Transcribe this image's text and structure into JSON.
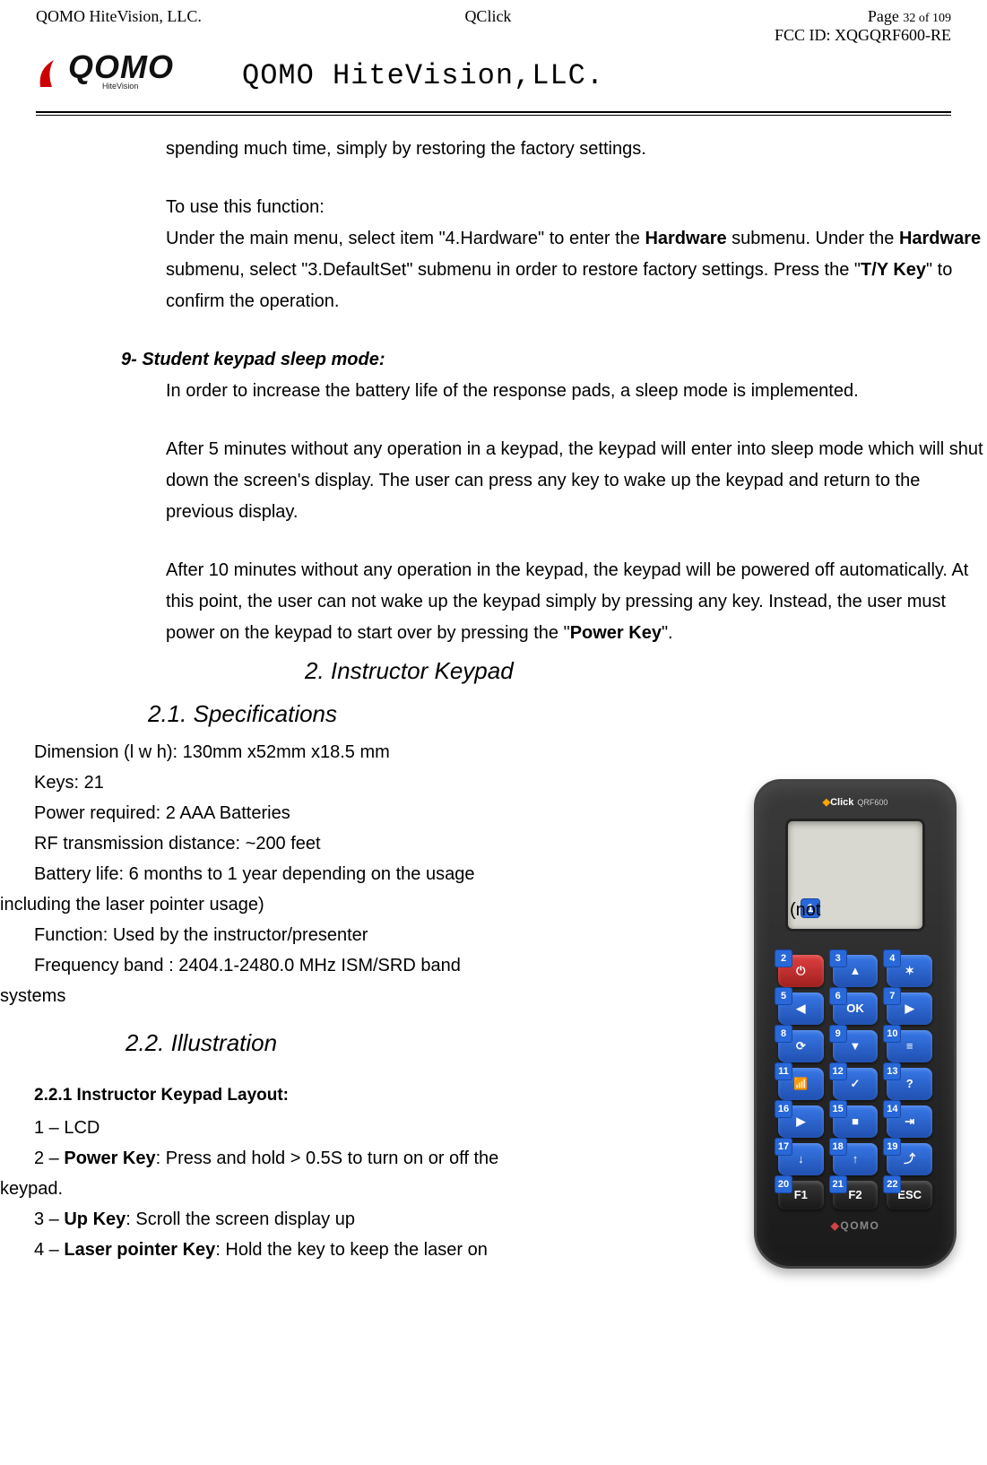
{
  "header": {
    "left": "QOMO HiteVision, LLC.",
    "center": "QClick",
    "page_label": "Page ",
    "page_current": "32",
    "page_of": " of ",
    "page_total": "109",
    "fcc": "FCC ID: XQGQRF600-RE"
  },
  "logo": {
    "brand": "QOMO",
    "sub": "HiteVision",
    "company": "QOMO HiteVision,LLC."
  },
  "body": {
    "p1": "spending much time, simply by restoring the factory settings.",
    "p2": "To use this function:",
    "p3a": "Under the main menu, select item \"4.Hardware\" to enter the ",
    "p3b": "Hardware",
    "p3c": " submenu. Under the ",
    "p3d": "Hardware",
    "p3e": " submenu, select \"3.DefaultSet\" submenu in order to restore factory settings. Press the \"",
    "p3f": "T/Y Key",
    "p3g": "\" to confirm the operation.",
    "s9": "9-  Student keypad sleep mode:",
    "p4": "In order to increase the battery life of the response pads, a sleep mode is implemented.",
    "p5": "After 5 minutes without any operation in a keypad, the keypad will enter into sleep mode which will shut down the screen's display. The user can press any key to wake up the keypad and return to the previous display.",
    "p6a": "After 10 minutes without any operation in the keypad, the keypad will be powered off automatically. At this point, the user can not wake up the keypad simply by pressing any key. Instead, the user must power on the keypad to start over by pressing the \"",
    "p6b": "Power Key",
    "p6c": "\".",
    "h2": "2. Instructor Keypad",
    "h21": "2.1. Specifications",
    "spec1": "Dimension (l w h): 130mm x52mm x18.5 mm",
    "spec2": "Keys: 21",
    "spec3": "Power required: 2 AAA Batteries",
    "spec4": "RF transmission distance: ~200 feet",
    "spec5": "Battery life:    6 months to 1 year depending on the usage",
    "spec5b": "(not",
    "spec5c": "including the laser pointer usage)",
    "spec6": "Function: Used by the instructor/presenter",
    "spec7": " Frequency band : 2404.1-2480.0 MHz ISM/SRD band",
    "spec7b": "systems",
    "h22": "2.2. Illustration",
    "h221": "2.2.1 Instructor Keypad Layout:",
    "k1": "1 – LCD",
    "k2a": "2 – ",
    "k2b": "Power Key",
    "k2c": ": Press and hold > 0.5S to turn on or off the",
    "k2d": "keypad.",
    "k3a": "3 – ",
    "k3b": "Up Key",
    "k3c": ": Scroll the screen display up",
    "k4a": "4 – ",
    "k4b": "Laser pointer Key",
    "k4c": ": Hold the key to keep the laser on"
  },
  "device": {
    "brand_logo": "Click",
    "model": "QRF600",
    "screen_badge": "1",
    "keys": [
      [
        {
          "n": "2",
          "icon": "⏻",
          "cls": "red"
        },
        {
          "n": "3",
          "icon": "▲",
          "cls": "blue"
        },
        {
          "n": "4",
          "icon": "✶",
          "cls": "blue"
        }
      ],
      [
        {
          "n": "5",
          "icon": "◀",
          "cls": "blue"
        },
        {
          "n": "6",
          "icon": "OK",
          "cls": "blue"
        },
        {
          "n": "7",
          "icon": "▶",
          "cls": "blue"
        }
      ],
      [
        {
          "n": "8",
          "icon": "⟳",
          "cls": "blue"
        },
        {
          "n": "9",
          "icon": "▼",
          "cls": "blue"
        },
        {
          "n": "10",
          "icon": "≡",
          "cls": "blue"
        }
      ],
      [
        {
          "n": "11",
          "icon": "📶",
          "cls": "blue"
        },
        {
          "n": "12",
          "icon": "✓",
          "cls": "blue"
        },
        {
          "n": "13",
          "icon": "?",
          "cls": "blue"
        }
      ],
      [
        {
          "n": "16",
          "icon": "▶",
          "cls": "blue"
        },
        {
          "n": "15",
          "icon": "■",
          "cls": "blue"
        },
        {
          "n": "14",
          "icon": "⇥",
          "cls": "blue"
        }
      ],
      [
        {
          "n": "17",
          "icon": "↓",
          "cls": "blue"
        },
        {
          "n": "18",
          "icon": "↑",
          "cls": "blue"
        },
        {
          "n": "19",
          "icon": "⤴",
          "cls": "blue"
        }
      ],
      [
        {
          "n": "20",
          "icon": "F1",
          "cls": "dark"
        },
        {
          "n": "21",
          "icon": "F2",
          "cls": "dark"
        },
        {
          "n": "22",
          "icon": "ESC",
          "cls": "dark"
        }
      ]
    ],
    "bottom": "QOMO"
  }
}
